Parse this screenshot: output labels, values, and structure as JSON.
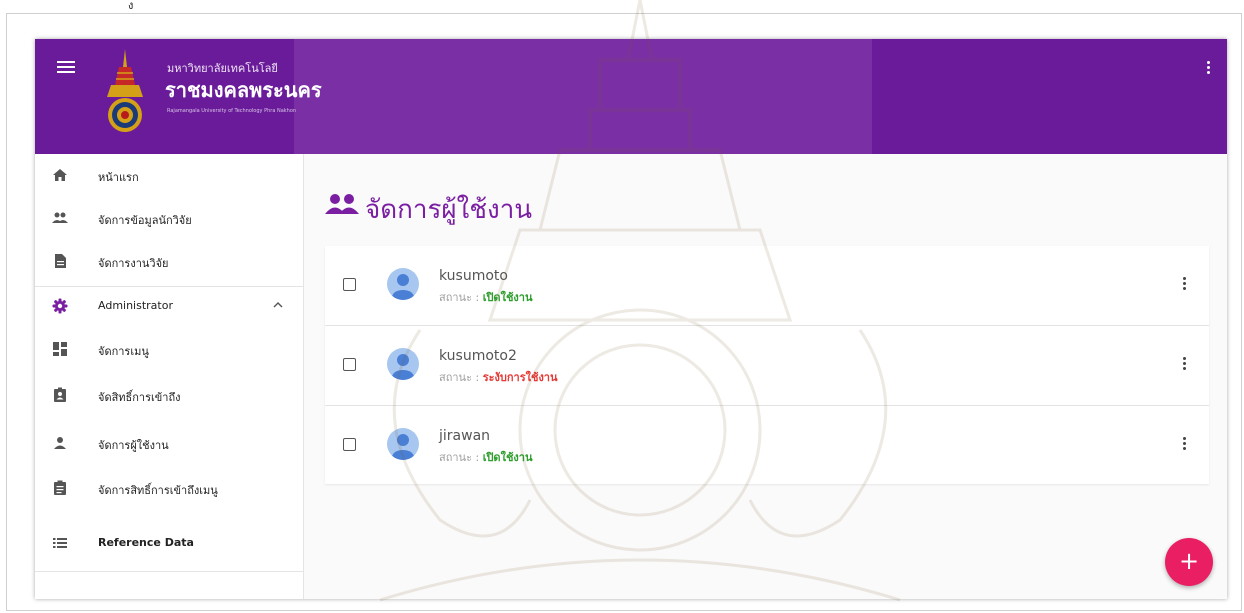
{
  "page_marker": "ง",
  "header": {
    "university_small": "มหาวิทยาลัยเทคโนโลยี",
    "university_big": "ราชมงคลพระนคร",
    "university_english": "Rajamangala University of Technology Phra Nakhon",
    "colors": {
      "primary": "#6a1b9a",
      "highlight": "#7a2fa5"
    }
  },
  "sidebar": {
    "items": [
      {
        "label": "หน้าแรก",
        "icon": "home-icon"
      },
      {
        "label": "จัดการข้อมูลนักวิจัย",
        "icon": "people-icon"
      },
      {
        "label": "จัดการงานวิจัย",
        "icon": "document-icon"
      },
      {
        "label": "Administrator",
        "icon": "gear-icon"
      },
      {
        "label": "จัดการเมนู",
        "icon": "dashboard-icon"
      },
      {
        "label": "จัดสิทธิ์การเข้าถึง",
        "icon": "badge-icon"
      },
      {
        "label": "จัดการผู้ใช้งาน",
        "icon": "person-icon"
      },
      {
        "label": "จัดการสิทธิ์การเข้าถึงเมนู",
        "icon": "clipboard-icon"
      },
      {
        "label": "Reference Data",
        "icon": "list-icon"
      }
    ]
  },
  "main": {
    "title": "จัดการผู้ใช้งาน",
    "status_label": "สถานะ : ",
    "users": [
      {
        "username": "kusumoto",
        "status": "เปิดใช้งาน",
        "status_color": "#2e9e2e"
      },
      {
        "username": "kusumoto2",
        "status": "ระงับการใช้งาน",
        "status_color": "#e53935"
      },
      {
        "username": "jirawan",
        "status": "เปิดใช้งาน",
        "status_color": "#2e9e2e"
      }
    ]
  },
  "fab": {
    "label": "+",
    "color": "#e91e63"
  }
}
